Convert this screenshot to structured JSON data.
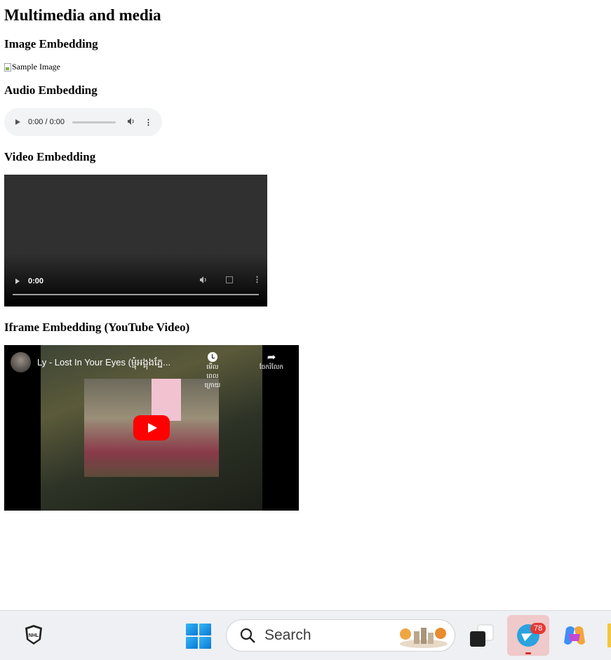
{
  "page": {
    "title": "Multimedia and media",
    "sections": {
      "image": "Image Embedding",
      "audio": "Audio Embedding",
      "video": "Video Embedding",
      "iframe": "Iframe Embedding (YouTube Video)"
    },
    "image_alt": "Sample Image"
  },
  "audio_player": {
    "time": "0:00 / 0:00",
    "volume_icon": "speaker-icon",
    "menu_icon": "more-vert-icon"
  },
  "video_player": {
    "time": "0:00",
    "volume_icon": "speaker-icon",
    "fullscreen_icon": "fullscreen-icon",
    "menu_icon": "more-vert-icon"
  },
  "youtube": {
    "video_title": "Ly - Lost In Your Eyes (ម្ជុំអង្គុងភ្នែ...",
    "watch_later_label": "មើលពេលក្រោយ",
    "share_label": "ចែករំលែក"
  },
  "taskbar": {
    "search_label": "Search",
    "telegram_badge": "78",
    "accent": "#2aa3de",
    "badge_color": "#e53935"
  }
}
